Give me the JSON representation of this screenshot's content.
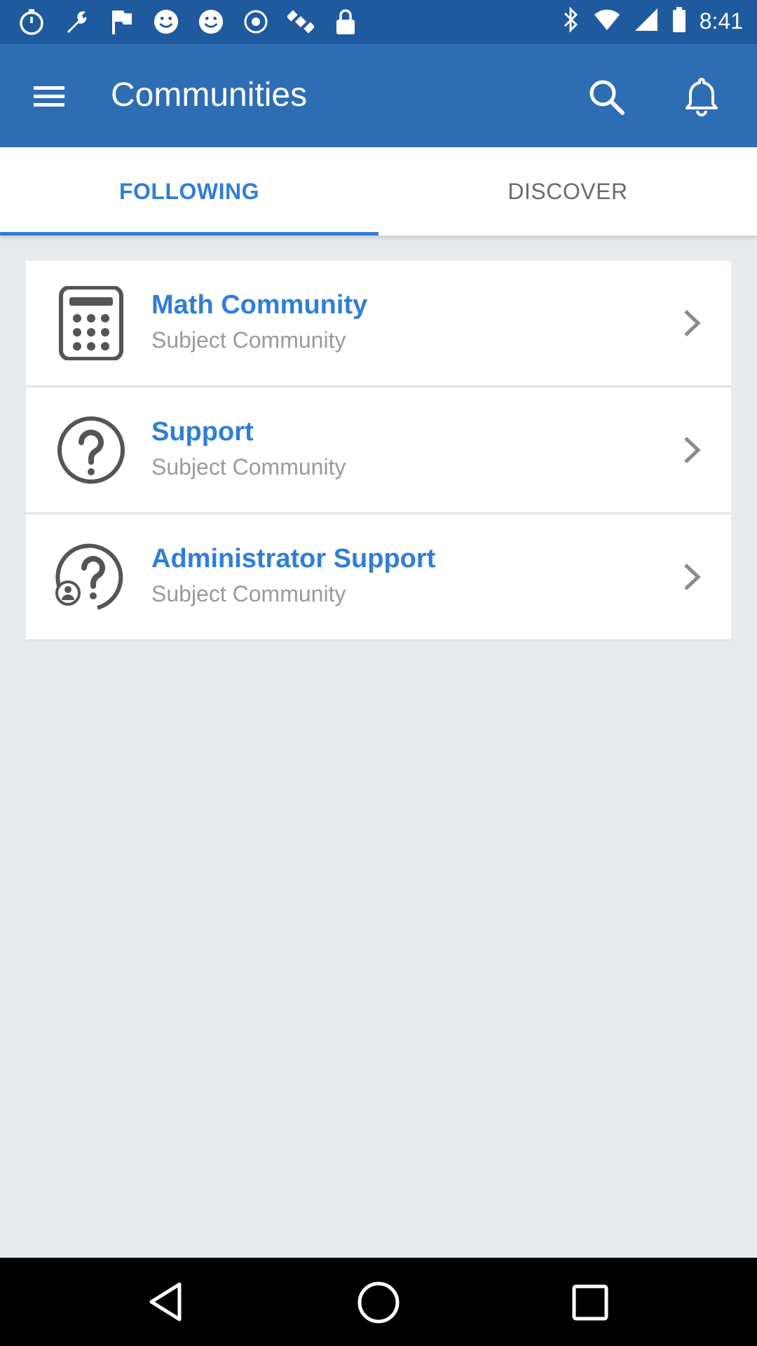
{
  "status_bar": {
    "time": "8:41",
    "icons": [
      "stopwatch-icon",
      "wrench-icon",
      "flag-icon",
      "smiley-icon",
      "smiley-icon",
      "settings-circle-icon",
      "satellite-icon",
      "lock-icon",
      "bluetooth-icon",
      "wifi-icon",
      "signal-icon",
      "battery-icon"
    ]
  },
  "app_bar": {
    "title": "Communities",
    "background": "#2e6db4"
  },
  "tabs": [
    {
      "label": "FOLLOWING",
      "selected": true
    },
    {
      "label": "DISCOVER",
      "selected": false
    }
  ],
  "communities": [
    {
      "title": "Math Community",
      "subtitle": "Subject Community",
      "icon": "calculator-icon"
    },
    {
      "title": "Support",
      "subtitle": "Subject Community",
      "icon": "question-circle-icon"
    },
    {
      "title": "Administrator Support",
      "subtitle": "Subject Community",
      "icon": "admin-question-icon"
    }
  ],
  "colors": {
    "accent": "#2f7ed8",
    "status_bar": "#1f5a9e",
    "background": "#e8ebee"
  }
}
